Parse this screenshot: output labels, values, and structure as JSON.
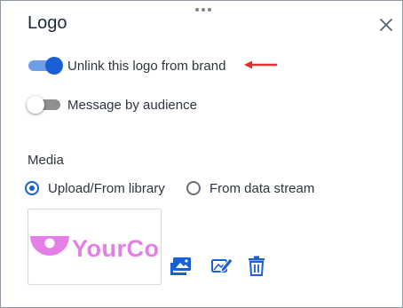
{
  "dialog": {
    "title": "Logo"
  },
  "toggles": [
    {
      "label": "Unlink this logo from brand",
      "state": "on"
    },
    {
      "label": "Message by audience",
      "state": "off"
    }
  ],
  "media": {
    "section_label": "Media",
    "options": [
      {
        "label": "Upload/From library",
        "selected": true
      },
      {
        "label": "From data stream",
        "selected": false
      }
    ],
    "logo_text": "YourCo"
  },
  "icons": {
    "drag_handle": "drag-handle-icon",
    "close": "close-icon",
    "replace_image": "image-library-icon",
    "edit_image": "edit-image-icon",
    "delete": "trash-icon",
    "annotation": "red-arrow-icon"
  },
  "colors": {
    "accent": "#1a5fd6",
    "toggle_on_track": "#6f9ee8",
    "logo": "#e37fe6",
    "annotation": "#e3302f"
  }
}
